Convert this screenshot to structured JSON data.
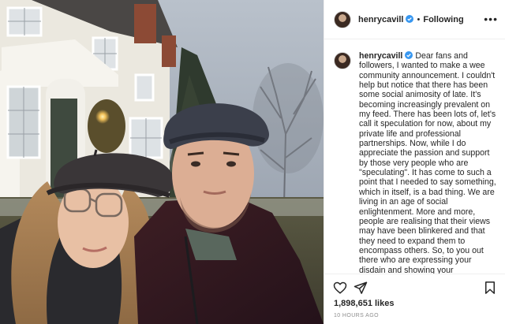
{
  "post": {
    "photo_alt": "Selfie of a couple in flat caps in front of a white house",
    "header": {
      "username": "henrycavill",
      "separator": "•",
      "follow_status": "Following",
      "more_label": "•••"
    },
    "caption": {
      "username": "henrycavill",
      "text": "Dear fans and followers, I wanted to make a wee community announcement. I couldn't help but notice that there has been some social animosity of late. It's becoming increasingly prevalent on my feed. There has been lots of, let's call it speculation for now, about my private life and professional partnerships. Now, while I do appreciate the passion and support by those very people who are \"speculating\". It has come to such a point that I needed to say something, which in itself, is a bad thing. We are living in an age of social enlightenment. More and more, people are realising that their views may have been blinkered and that they need to expand them to encompass others. So, to you out there who are expressing your disdain and showing your displeasure through a surprising variety of ways, it's time to"
    },
    "likes": "1,898,651 likes",
    "timestamp": "10 HOURS AGO"
  },
  "icons": [
    "verified-badge-icon",
    "heart-icon",
    "share-icon",
    "bookmark-icon",
    "more-options-icon"
  ],
  "colors": {
    "verified": "#3897f0",
    "text": "#262626",
    "muted": "#8e8e8e",
    "divider": "#efefef"
  }
}
